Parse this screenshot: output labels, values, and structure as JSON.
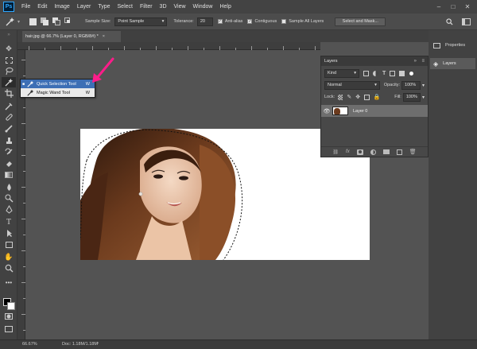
{
  "app": {
    "logo": "Ps"
  },
  "menu": [
    "File",
    "Edit",
    "Image",
    "Layer",
    "Type",
    "Select",
    "Filter",
    "3D",
    "View",
    "Window",
    "Help"
  ],
  "window_controls": {
    "minimize": "–",
    "maximize": "□",
    "close": "✕"
  },
  "options": {
    "sample_size_label": "Sample Size:",
    "sample_size_value": "Point Sample",
    "tolerance_label": "Tolerance:",
    "tolerance_value": "20",
    "anti_alias_label": "Anti-alias",
    "contiguous_label": "Contiguous",
    "sample_all_label": "Sample All Layers",
    "select_mask_label": "Select and Mask..."
  },
  "document_tab": {
    "title": "hair.jpg @ 66.7% (Layer 0, RGB/8#) *",
    "close": "×"
  },
  "flyout": [
    {
      "label": "Quick Selection Tool",
      "shortcut": "W"
    },
    {
      "label": "Magic Wand Tool",
      "shortcut": "W"
    }
  ],
  "layers_panel": {
    "title": "Layers",
    "kind_label": "Kind",
    "blend_mode": "Normal",
    "opacity_label": "Opacity:",
    "opacity_value": "100%",
    "lock_label": "Lock:",
    "fill_label": "Fill:",
    "fill_value": "100%",
    "layer_name": "Layer 0",
    "fx_label": "fx"
  },
  "right_dock": {
    "properties_label": "Properties",
    "layers_label": "Layers"
  },
  "status": {
    "zoom": "66.67%",
    "doc": "Doc: 1.18M/1.18M"
  },
  "colors": {
    "accent_arrow": "#ff1c8a",
    "selection_highlight": "#3d6fb5"
  }
}
